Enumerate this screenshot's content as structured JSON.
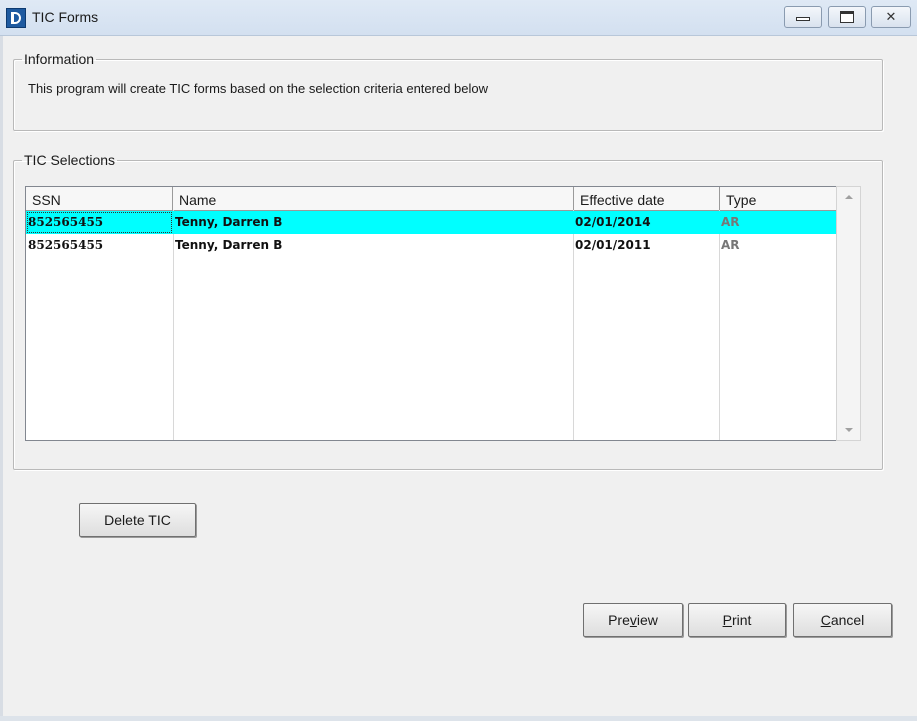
{
  "window": {
    "title": "TIC Forms",
    "icon": "app-logo-icon",
    "controls": {
      "minimize": "minimize-icon",
      "maximize": "maximize-icon",
      "close": "close-icon",
      "close_glyph": "✕"
    }
  },
  "information": {
    "legend": "Information",
    "text": "This program will create TIC forms based on the selection criteria entered below"
  },
  "selections": {
    "legend": "TIC Selections",
    "columns": [
      "SSN",
      "Name",
      "Effective date",
      "Type"
    ],
    "rows": [
      {
        "ssn": "852565455",
        "name": "Tenny, Darren B",
        "effective_date": "02/01/2014",
        "type": "AR",
        "selected": true
      },
      {
        "ssn": "852565455",
        "name": "Tenny, Darren B",
        "effective_date": "02/01/2011",
        "type": "AR",
        "selected": false
      }
    ],
    "selected_color": "#00ffff"
  },
  "buttons": {
    "delete_tic": "Delete TIC",
    "preview_pre": "Pre",
    "preview_mnemonic": "v",
    "preview_post": "iew",
    "print_mnemonic": "P",
    "print_post": "rint",
    "cancel_mnemonic": "C",
    "cancel_post": "ancel"
  }
}
